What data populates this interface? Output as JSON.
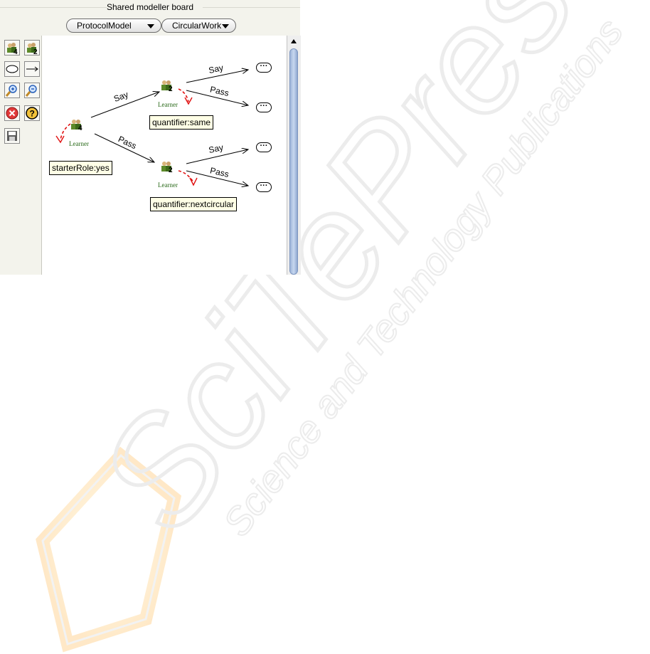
{
  "panel": {
    "title": "Shared modeller board",
    "dropdowns": [
      {
        "value": "ProtocolModel"
      },
      {
        "value": "CircularWork"
      }
    ]
  },
  "toolbar": {
    "tools": [
      {
        "icon": "add-role-4-icon"
      },
      {
        "icon": "add-role-2-icon"
      },
      {
        "icon": "ellipse-node-icon"
      },
      {
        "icon": "arrow-connector-icon"
      },
      {
        "icon": "zoom-in-icon"
      },
      {
        "icon": "zoom-out-icon"
      },
      {
        "icon": "delete-icon"
      },
      {
        "icon": "help-icon"
      },
      {
        "icon": "save-icon"
      }
    ]
  },
  "diagram": {
    "root": {
      "label": "Learner",
      "attribute": "starterRole:yes"
    },
    "upper": {
      "label": "Learner",
      "attribute": "quantifier:same"
    },
    "lower": {
      "label": "Learner",
      "attribute": "quantifier:nextcircular"
    },
    "edges": {
      "root_upper": "Say",
      "root_lower": "Pass",
      "upper_say": "Say",
      "upper_pass": "Pass",
      "lower_say": "Say",
      "lower_pass": "Pass"
    },
    "ellipsis": "···"
  },
  "watermark": {
    "brand": "SciTePress",
    "tagline": "Science and Technology Publications"
  },
  "colors": {
    "selfLoop": "#e01010",
    "nodeLabel": "#2a6a1a",
    "attrBackground": "#ffffe6",
    "scrollThumb": "#aec3e4"
  }
}
